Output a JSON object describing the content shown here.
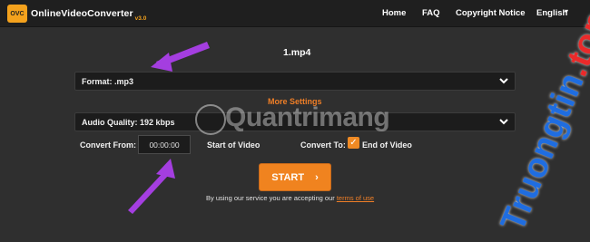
{
  "header": {
    "logo_badge": "OVC",
    "logo_text": "OnlineVideoConverter",
    "logo_version": "v3.0",
    "nav": {
      "home": "Home",
      "faq": "FAQ",
      "copyright": "Copyright Notice",
      "language": "English"
    }
  },
  "main": {
    "filename": "1.mp4",
    "format_select": "Format: .mp3",
    "more_settings": "More Settings",
    "audio_quality_select": "Audio Quality: 192 kbps",
    "convert_from_label": "Convert From:",
    "convert_from_value": "00:00:00",
    "start_of_video": "Start of Video",
    "convert_to_label": "Convert To:",
    "end_of_video_checked": true,
    "end_of_video": "End of Video",
    "start_button": "START",
    "terms_prefix": "By using our service you are accepting our",
    "terms_link": "terms of use"
  },
  "watermarks": {
    "quantrimang": "Quantrimang",
    "truongtin_part1": "Truongtin",
    "truongtin_part2": ".top"
  },
  "colors": {
    "accent_orange": "#f0831f",
    "annotation_purple": "#a43ee0",
    "background": "#2f2f2f",
    "navbar": "#1f1f1f"
  },
  "icons": {
    "language_chevron": "chevron-down-icon",
    "select_chevron": "chevron-down-icon",
    "checkbox": "checkmark-icon",
    "start_arrow": "chevron-right-icon"
  }
}
